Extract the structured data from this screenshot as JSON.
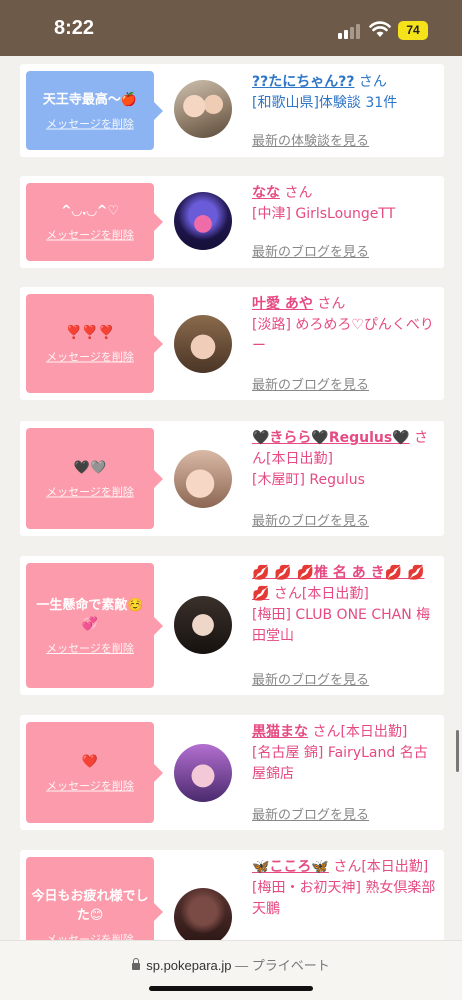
{
  "status_bar": {
    "time": "8:22",
    "battery": "74",
    "battery_color": "#f5e21a"
  },
  "cards": [
    {
      "bubble_color": "blue",
      "message": "天王寺最高〜🍎",
      "delete_label": "メッセージを削除",
      "name": "??たにちゃん??",
      "san": " さん",
      "details": [
        "[和歌山県]体験談 31件"
      ],
      "latest": "最新の体験談を見る",
      "text_color": "blue"
    },
    {
      "bubble_color": "pink",
      "message": "^◡.◡^♡",
      "delete_label": "メッセージを削除",
      "name": "なな",
      "san": " さん",
      "details": [
        "[中津] GirlsLoungeTT"
      ],
      "latest": "最新のブログを見る",
      "text_color": "pink"
    },
    {
      "bubble_color": "pink",
      "message": "❣️❣️❣️",
      "delete_label": "メッセージを削除",
      "name": "叶愛 あや",
      "san": " さん",
      "details": [
        "[淡路] めろめろ♡ぴんくべりー"
      ],
      "latest": "最新のブログを見る",
      "text_color": "pink"
    },
    {
      "bubble_color": "pink",
      "message": "🖤🩶",
      "delete_label": "メッセージを削除",
      "name": "🖤きらら🖤Regulus🖤",
      "san": " さん[本日出勤]",
      "details": [
        "[木屋町] Regulus"
      ],
      "latest": "最新のブログを見る",
      "text_color": "pink"
    },
    {
      "bubble_color": "pink",
      "message": "一生懸命で素敵☺️💞",
      "delete_label": "メッセージを削除",
      "name": "💋 💋 💋椎 名 あ き💋 💋 💋",
      "san": " さん[本日出勤]",
      "details": [
        "[梅田] CLUB ONE CHAN 梅田堂山"
      ],
      "latest": "最新のブログを見る",
      "text_color": "pink"
    },
    {
      "bubble_color": "pink",
      "message": "❤️",
      "delete_label": "メッセージを削除",
      "name": "黒猫まな",
      "san": " さん[本日出勤]",
      "details": [
        "[名古屋 錦] FairyLand 名古屋錦店"
      ],
      "latest": "最新のブログを見る",
      "text_color": "pink"
    },
    {
      "bubble_color": "pink",
      "message": "今日もお疲れ様でした😊",
      "delete_label": "メッセージを削除",
      "name": "🦋こころ🦋",
      "san": " さん[本日出勤]",
      "details": [
        "[梅田・お初天神] 熟女倶楽部 天鵬"
      ],
      "latest": "",
      "text_color": "pink"
    }
  ],
  "browser": {
    "url": "sp.pokepara.jp",
    "separator": " — ",
    "mode": "プライベート"
  },
  "colors": {
    "pink_bubble": "#fc9bab",
    "blue_bubble": "#8db4f2",
    "pink_text": "#e64a82",
    "blue_text": "#2f76c6",
    "status_bar": "#6e5a48"
  }
}
